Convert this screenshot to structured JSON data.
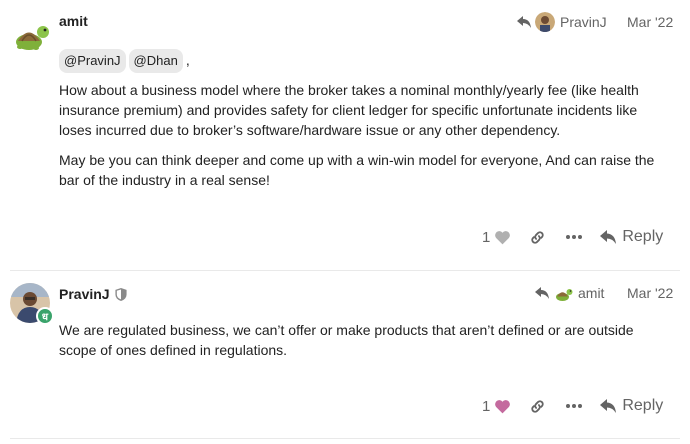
{
  "posts": [
    {
      "username": "amit",
      "reply_to": "PravinJ",
      "date": "Mar '22",
      "mentions": [
        "@PravinJ",
        "@Dhan"
      ],
      "mention_suffix": ",",
      "paragraphs": [
        "How about a business model where the broker takes a nominal monthly/yearly fee (like health insurance premium) and provides safety for client ledger for specific unfortunate incidents like loses incurred due to broker’s software/hardware issue or any other dependency.",
        "May be you can think deeper and come up with a win-win model for everyone, And can raise the bar of the industry in a real sense!"
      ],
      "like_count": "1",
      "reply_label": "Reply",
      "heart_color": "#b0b0b0"
    },
    {
      "username": "PravinJ",
      "reply_to": "amit",
      "date": "Mar '22",
      "paragraphs": [
        "We are regulated business, we can’t offer or make products that aren’t defined or are outside scope of ones defined in regulations."
      ],
      "like_count": "1",
      "reply_label": "Reply",
      "heart_color": "#c46a9e",
      "badge_letter": "ध"
    }
  ],
  "colors": {
    "muted": "#646464",
    "mention_bg": "#e9e9e9",
    "badge_green": "#3aa36b"
  }
}
